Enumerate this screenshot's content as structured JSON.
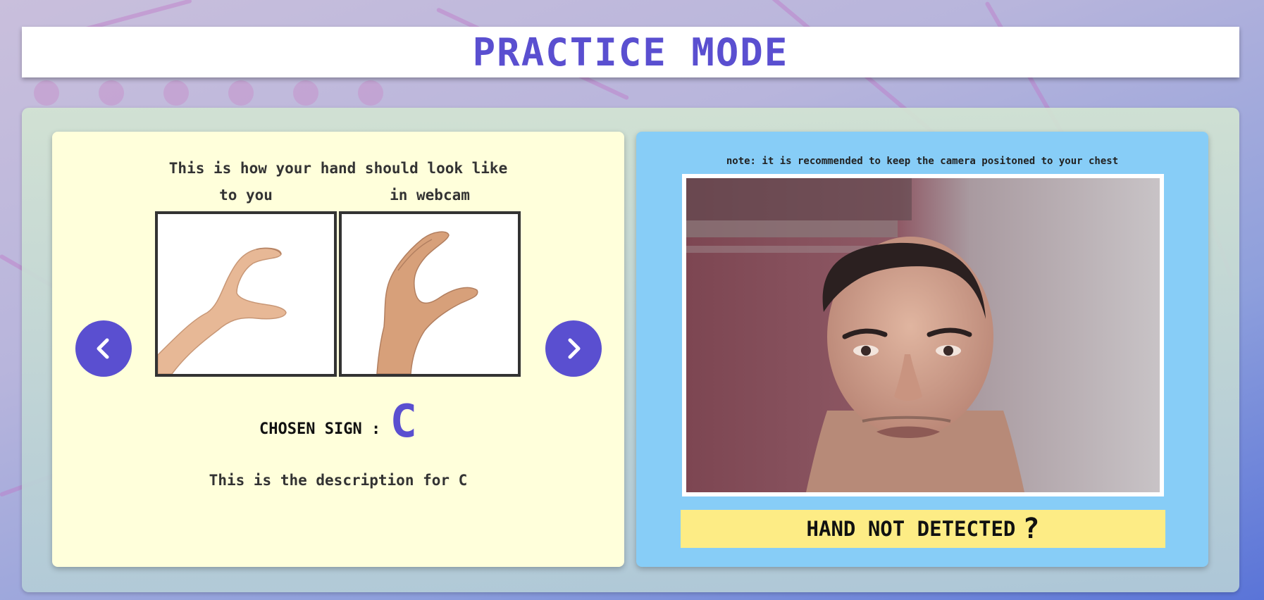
{
  "header": {
    "title": "PRACTICE MODE"
  },
  "practice": {
    "intro": "This is how your hand should look like",
    "caption_you": "to you",
    "caption_webcam": "in webcam",
    "chosen_label": "CHOSEN SIGN :",
    "chosen_letter": "C",
    "description": "This is the description for C",
    "prev_icon": "chevron-left-icon",
    "next_icon": "chevron-right-icon"
  },
  "camera": {
    "note": "note: it is recommended to keep the camera positoned to your chest",
    "status_text": "HAND NOT DETECTED",
    "status_symbol": "?"
  },
  "colors": {
    "accent": "#5a4fd0",
    "left_panel": "#ffffdb",
    "right_panel": "#87cdf7",
    "status_bg": "#fdec85"
  }
}
